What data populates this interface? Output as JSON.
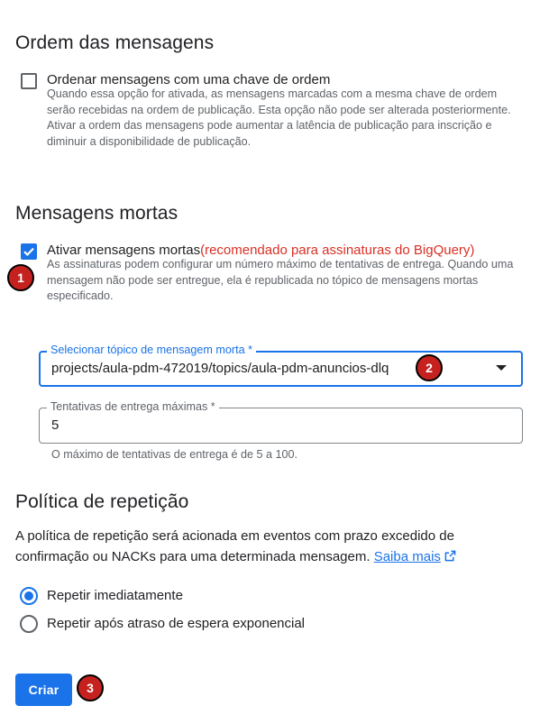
{
  "ordering": {
    "heading": "Ordem das mensagens",
    "checkbox_label": "Ordenar mensagens com uma chave de ordem",
    "checked": false,
    "help": "Quando essa opção for ativada, as mensagens marcadas com a mesma chave de ordem serão recebidas na ordem de publicação. Esta opção não pode ser alterada posteriormente. Ativar a ordem das mensagens pode aumentar a latência de publicação para inscrição e diminuir a disponibilidade de publicação."
  },
  "dead_letter": {
    "heading": "Mensagens mortas",
    "checkbox_label": "Ativar mensagens mortas",
    "recommended": "(recomendado para assinaturas do BigQuery)",
    "checked": true,
    "help": "As assinaturas podem configurar um número máximo de tentativas de entrega. Quando uma mensagem não pode ser entregue, ela é republicada no tópico de mensagens mortas especificado.",
    "topic_field": {
      "label": "Selecionar tópico de mensagem morta *",
      "value": "projects/aula-pdm-472019/topics/aula-pdm-anuncios-dlq"
    },
    "attempts_field": {
      "label": "Tentativas de entrega máximas *",
      "value": "5",
      "hint": "O máximo de tentativas de entrega é de 5 a 100."
    }
  },
  "retry": {
    "heading": "Política de repetição",
    "description": "A política de repetição será acionada em eventos com prazo excedido de confirmação ou NACKs para uma determinada mensagem.",
    "learn_more": "Saiba mais",
    "options": [
      {
        "label": "Repetir imediatamente",
        "selected": true
      },
      {
        "label": "Repetir após atraso de espera exponencial",
        "selected": false
      }
    ]
  },
  "create_button": "Criar",
  "annotations": [
    "1",
    "2",
    "3"
  ],
  "colors": {
    "primary": "#1a73e8",
    "danger": "#d93025",
    "badge": "#c5221f"
  }
}
